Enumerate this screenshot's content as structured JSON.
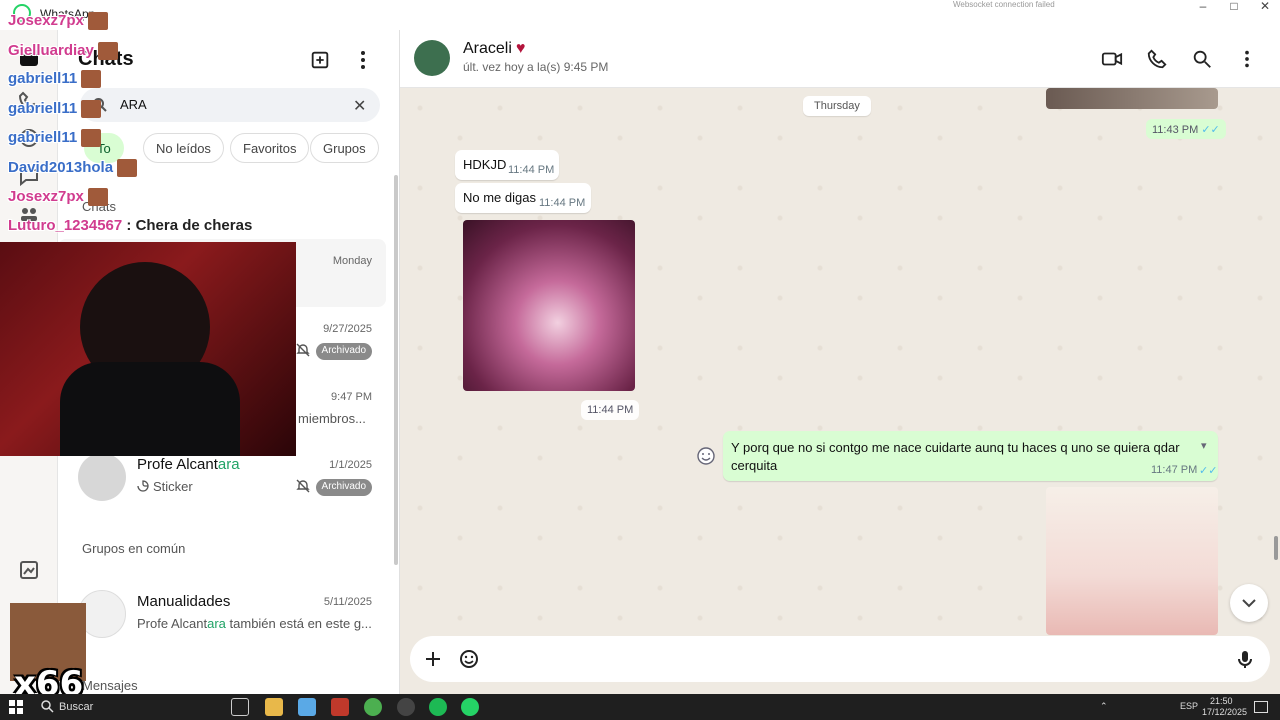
{
  "window": {
    "title": "WhatsApp",
    "ws_status": "Websocket connection failed"
  },
  "sidebar": {
    "header": "Chats",
    "search": {
      "value": "ARA"
    },
    "filters": [
      {
        "label": "To"
      },
      {
        "label": "No leídos"
      },
      {
        "label": "Favoritos"
      },
      {
        "label": "Grupos"
      }
    ],
    "section_chats": "Chats",
    "chats": [
      {
        "date": "Monday"
      },
      {
        "date": "9/27/2025",
        "badge": "Archivado"
      },
      {
        "date": "9:47 PM",
        "sub": "miembros..."
      },
      {
        "name_pre": "Profe Alcant",
        "name_hl": "ara",
        "date": "1/1/2025",
        "sub": "Sticker",
        "badge": "Archivado"
      }
    ],
    "section_groups": "Grupos en común",
    "groups": [
      {
        "name": "Manualidades",
        "date": "5/11/2025",
        "sub_pre": "Profe Alcant",
        "sub_hl": "ara",
        "sub_post": " también está en este g..."
      }
    ],
    "section_messages": "Mensajes"
  },
  "chat": {
    "contact": "Araceli",
    "heart": "♥",
    "last_seen": "últ. vez hoy a la(s) 9:45 PM",
    "day_divider": "Thursday",
    "messages": [
      {
        "dir": "out",
        "time": "11:43 PM"
      },
      {
        "dir": "in",
        "text": "HDKJD",
        "time": "11:44 PM"
      },
      {
        "dir": "in",
        "text": "No me digas",
        "time": "11:44 PM"
      },
      {
        "dir": "in",
        "kind": "image",
        "time": "11:44 PM"
      },
      {
        "dir": "out",
        "text": "Y porq que no si contgo me nace cuidarte  aunq tu haces q uno se quiera qdar cerquita",
        "time": "11:47 PM"
      }
    ]
  },
  "stream_overlay": {
    "chat_lines": [
      {
        "user": "Josexz7px",
        "text": ""
      },
      {
        "user": "Gielluardiay",
        "text": ""
      },
      {
        "user": "gabriell11",
        "text": ""
      },
      {
        "user": "gabriell11",
        "text": ""
      },
      {
        "user": "gabriell11",
        "text": ""
      },
      {
        "user": "David2013hola",
        "text": ""
      },
      {
        "user": "Josexz7px",
        "text": ""
      },
      {
        "user": "Luturo_1234567",
        "text": " : Chera de cheras"
      }
    ],
    "counter": "x66"
  },
  "taskbar": {
    "search": "Buscar",
    "lang": "ESP",
    "time": "21:50",
    "date": "17/12/2025"
  },
  "colors": {
    "accent": "#25d366",
    "outgoing": "#d9fdd3",
    "chat_bg": "#efeae2",
    "archived_badge": "#8a8a8a"
  }
}
